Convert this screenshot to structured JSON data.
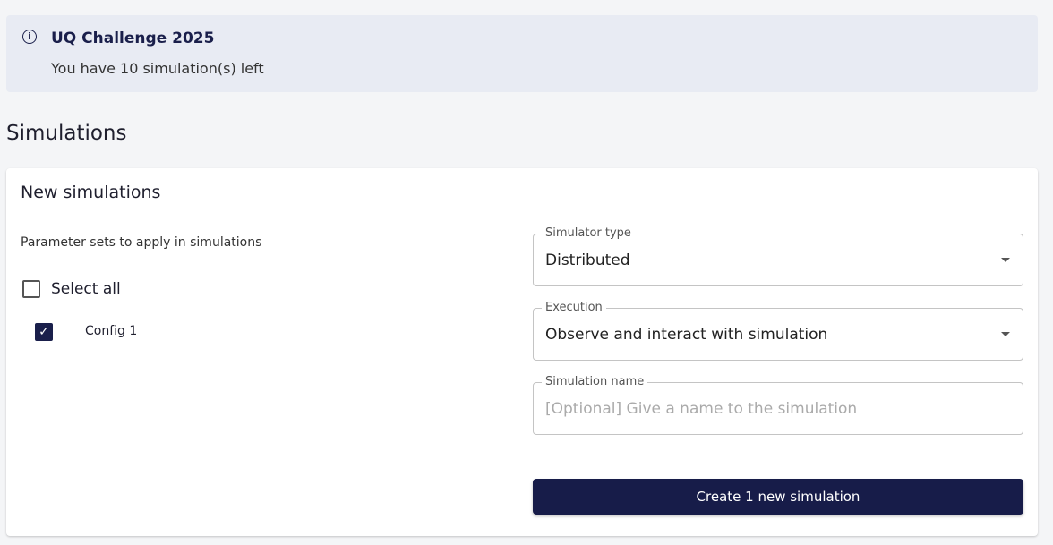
{
  "alert": {
    "title": "UQ Challenge 2025",
    "message": "You have 10 simulation(s) left"
  },
  "page_title": "Simulations",
  "card": {
    "title": "New simulations",
    "param_label": "Parameter sets to apply in simulations",
    "select_all": "Select all",
    "configs": [
      {
        "label": "Config 1",
        "checked": true
      }
    ],
    "simulator_type": {
      "label": "Simulator type",
      "value": "Distributed"
    },
    "execution": {
      "label": "Execution",
      "value": "Observe and interact with simulation"
    },
    "simulation_name": {
      "label": "Simulation name",
      "placeholder": "[Optional] Give a name to the simulation",
      "value": ""
    },
    "create_button": "Create 1 new simulation"
  }
}
